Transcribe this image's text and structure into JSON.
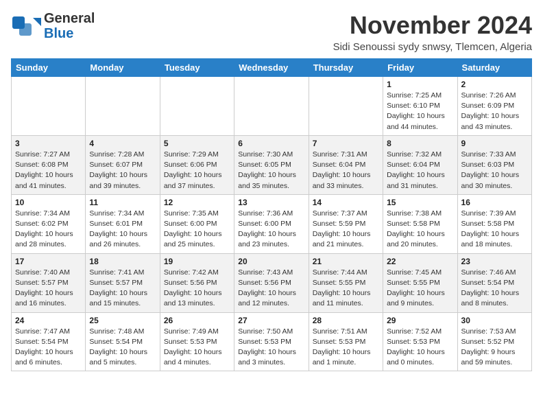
{
  "header": {
    "logo_line1": "General",
    "logo_line2": "Blue",
    "month": "November 2024",
    "location": "Sidi Senoussi sydy snwsy, Tlemcen, Algeria"
  },
  "weekdays": [
    "Sunday",
    "Monday",
    "Tuesday",
    "Wednesday",
    "Thursday",
    "Friday",
    "Saturday"
  ],
  "weeks": [
    [
      {
        "day": "",
        "info": ""
      },
      {
        "day": "",
        "info": ""
      },
      {
        "day": "",
        "info": ""
      },
      {
        "day": "",
        "info": ""
      },
      {
        "day": "",
        "info": ""
      },
      {
        "day": "1",
        "info": "Sunrise: 7:25 AM\nSunset: 6:10 PM\nDaylight: 10 hours and 44 minutes."
      },
      {
        "day": "2",
        "info": "Sunrise: 7:26 AM\nSunset: 6:09 PM\nDaylight: 10 hours and 43 minutes."
      }
    ],
    [
      {
        "day": "3",
        "info": "Sunrise: 7:27 AM\nSunset: 6:08 PM\nDaylight: 10 hours and 41 minutes."
      },
      {
        "day": "4",
        "info": "Sunrise: 7:28 AM\nSunset: 6:07 PM\nDaylight: 10 hours and 39 minutes."
      },
      {
        "day": "5",
        "info": "Sunrise: 7:29 AM\nSunset: 6:06 PM\nDaylight: 10 hours and 37 minutes."
      },
      {
        "day": "6",
        "info": "Sunrise: 7:30 AM\nSunset: 6:05 PM\nDaylight: 10 hours and 35 minutes."
      },
      {
        "day": "7",
        "info": "Sunrise: 7:31 AM\nSunset: 6:04 PM\nDaylight: 10 hours and 33 minutes."
      },
      {
        "day": "8",
        "info": "Sunrise: 7:32 AM\nSunset: 6:04 PM\nDaylight: 10 hours and 31 minutes."
      },
      {
        "day": "9",
        "info": "Sunrise: 7:33 AM\nSunset: 6:03 PM\nDaylight: 10 hours and 30 minutes."
      }
    ],
    [
      {
        "day": "10",
        "info": "Sunrise: 7:34 AM\nSunset: 6:02 PM\nDaylight: 10 hours and 28 minutes."
      },
      {
        "day": "11",
        "info": "Sunrise: 7:34 AM\nSunset: 6:01 PM\nDaylight: 10 hours and 26 minutes."
      },
      {
        "day": "12",
        "info": "Sunrise: 7:35 AM\nSunset: 6:00 PM\nDaylight: 10 hours and 25 minutes."
      },
      {
        "day": "13",
        "info": "Sunrise: 7:36 AM\nSunset: 6:00 PM\nDaylight: 10 hours and 23 minutes."
      },
      {
        "day": "14",
        "info": "Sunrise: 7:37 AM\nSunset: 5:59 PM\nDaylight: 10 hours and 21 minutes."
      },
      {
        "day": "15",
        "info": "Sunrise: 7:38 AM\nSunset: 5:58 PM\nDaylight: 10 hours and 20 minutes."
      },
      {
        "day": "16",
        "info": "Sunrise: 7:39 AM\nSunset: 5:58 PM\nDaylight: 10 hours and 18 minutes."
      }
    ],
    [
      {
        "day": "17",
        "info": "Sunrise: 7:40 AM\nSunset: 5:57 PM\nDaylight: 10 hours and 16 minutes."
      },
      {
        "day": "18",
        "info": "Sunrise: 7:41 AM\nSunset: 5:57 PM\nDaylight: 10 hours and 15 minutes."
      },
      {
        "day": "19",
        "info": "Sunrise: 7:42 AM\nSunset: 5:56 PM\nDaylight: 10 hours and 13 minutes."
      },
      {
        "day": "20",
        "info": "Sunrise: 7:43 AM\nSunset: 5:56 PM\nDaylight: 10 hours and 12 minutes."
      },
      {
        "day": "21",
        "info": "Sunrise: 7:44 AM\nSunset: 5:55 PM\nDaylight: 10 hours and 11 minutes."
      },
      {
        "day": "22",
        "info": "Sunrise: 7:45 AM\nSunset: 5:55 PM\nDaylight: 10 hours and 9 minutes."
      },
      {
        "day": "23",
        "info": "Sunrise: 7:46 AM\nSunset: 5:54 PM\nDaylight: 10 hours and 8 minutes."
      }
    ],
    [
      {
        "day": "24",
        "info": "Sunrise: 7:47 AM\nSunset: 5:54 PM\nDaylight: 10 hours and 6 minutes."
      },
      {
        "day": "25",
        "info": "Sunrise: 7:48 AM\nSunset: 5:54 PM\nDaylight: 10 hours and 5 minutes."
      },
      {
        "day": "26",
        "info": "Sunrise: 7:49 AM\nSunset: 5:53 PM\nDaylight: 10 hours and 4 minutes."
      },
      {
        "day": "27",
        "info": "Sunrise: 7:50 AM\nSunset: 5:53 PM\nDaylight: 10 hours and 3 minutes."
      },
      {
        "day": "28",
        "info": "Sunrise: 7:51 AM\nSunset: 5:53 PM\nDaylight: 10 hours and 1 minute."
      },
      {
        "day": "29",
        "info": "Sunrise: 7:52 AM\nSunset: 5:53 PM\nDaylight: 10 hours and 0 minutes."
      },
      {
        "day": "30",
        "info": "Sunrise: 7:53 AM\nSunset: 5:52 PM\nDaylight: 9 hours and 59 minutes."
      }
    ]
  ]
}
